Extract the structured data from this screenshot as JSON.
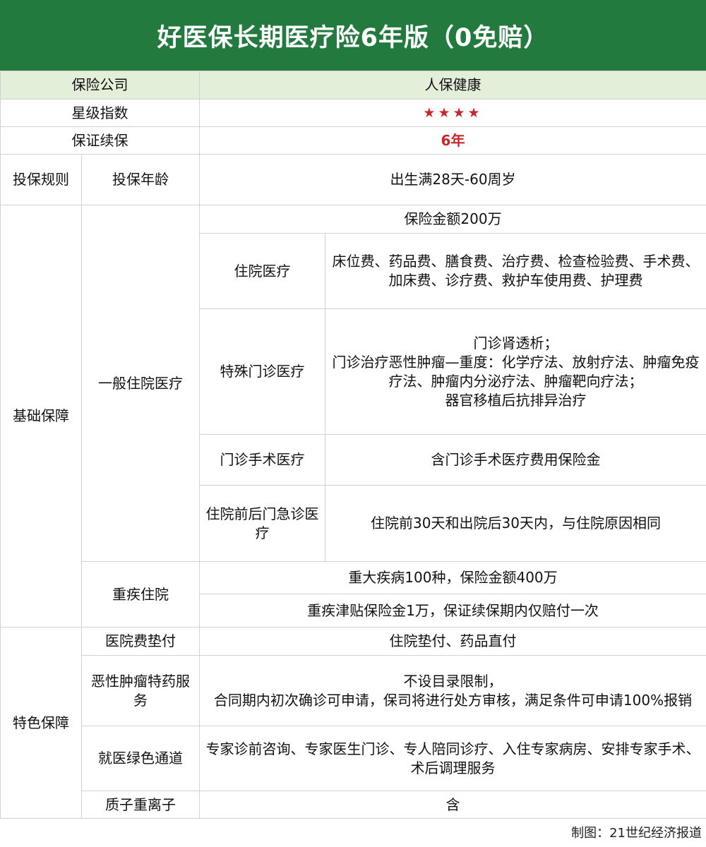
{
  "title": "好医保长期医疗险6年版（0免赔）",
  "rows": {
    "company": {
      "label": "保险公司",
      "value": "人保健康"
    },
    "stars": {
      "label": "星级指数",
      "value": "★★★★"
    },
    "renewal": {
      "label": "保证续保",
      "value": "6年"
    },
    "rules": {
      "category": "投保规则",
      "label": "投保年龄",
      "value": "出生满28天-60周岁"
    }
  },
  "basic": {
    "category": "基础保障",
    "general": {
      "label": "一般住院医疗",
      "amount": "保险金额200万",
      "items": [
        {
          "label": "住院医疗",
          "value": "床位费、药品费、膳食费、治疗费、检查检验费、手术费、加床费、诊疗费、救护车使用费、护理费"
        },
        {
          "label": "特殊门诊医疗",
          "lines": [
            "门诊肾透析；",
            "门诊治疗恶性肿瘤—重度：化学疗法、放射疗法、肿瘤免疫疗法、肿瘤内分泌疗法、肿瘤靶向疗法；",
            "器官移植后抗排异治疗"
          ]
        },
        {
          "label": "门诊手术医疗",
          "value": "含门诊手术医疗费用保险金"
        },
        {
          "label": "住院前后门急诊医疗",
          "value": "住院前30天和出院后30天内，与住院原因相同"
        }
      ]
    },
    "critical": {
      "label": "重疾住院",
      "value1": "重大疾病100种，保险金额400万",
      "value2": "重疾津贴保险金1万，保证续保期内仅赔付一次"
    }
  },
  "special": {
    "category": "特色保障",
    "items": [
      {
        "label": "医院费垫付",
        "value": "住院垫付、药品直付"
      },
      {
        "label": "恶性肿瘤特药服务",
        "lines": [
          "不设目录限制，",
          "合同期内初次确诊可申请，保司将进行处方审核，满足条件可申请100%报销"
        ]
      },
      {
        "label": "就医绿色通道",
        "value": "专家诊前咨询、专家医生门诊、专人陪同诊疗、入住专家病房、安排专家手术、术后调理服务"
      },
      {
        "label": "质子重离子",
        "value": "含"
      }
    ]
  },
  "footer": "制图：21世纪经济报道",
  "colors": {
    "header_bg": "#237a3f",
    "row_green": "#e3efd9",
    "accent_red": "#c8262b"
  }
}
